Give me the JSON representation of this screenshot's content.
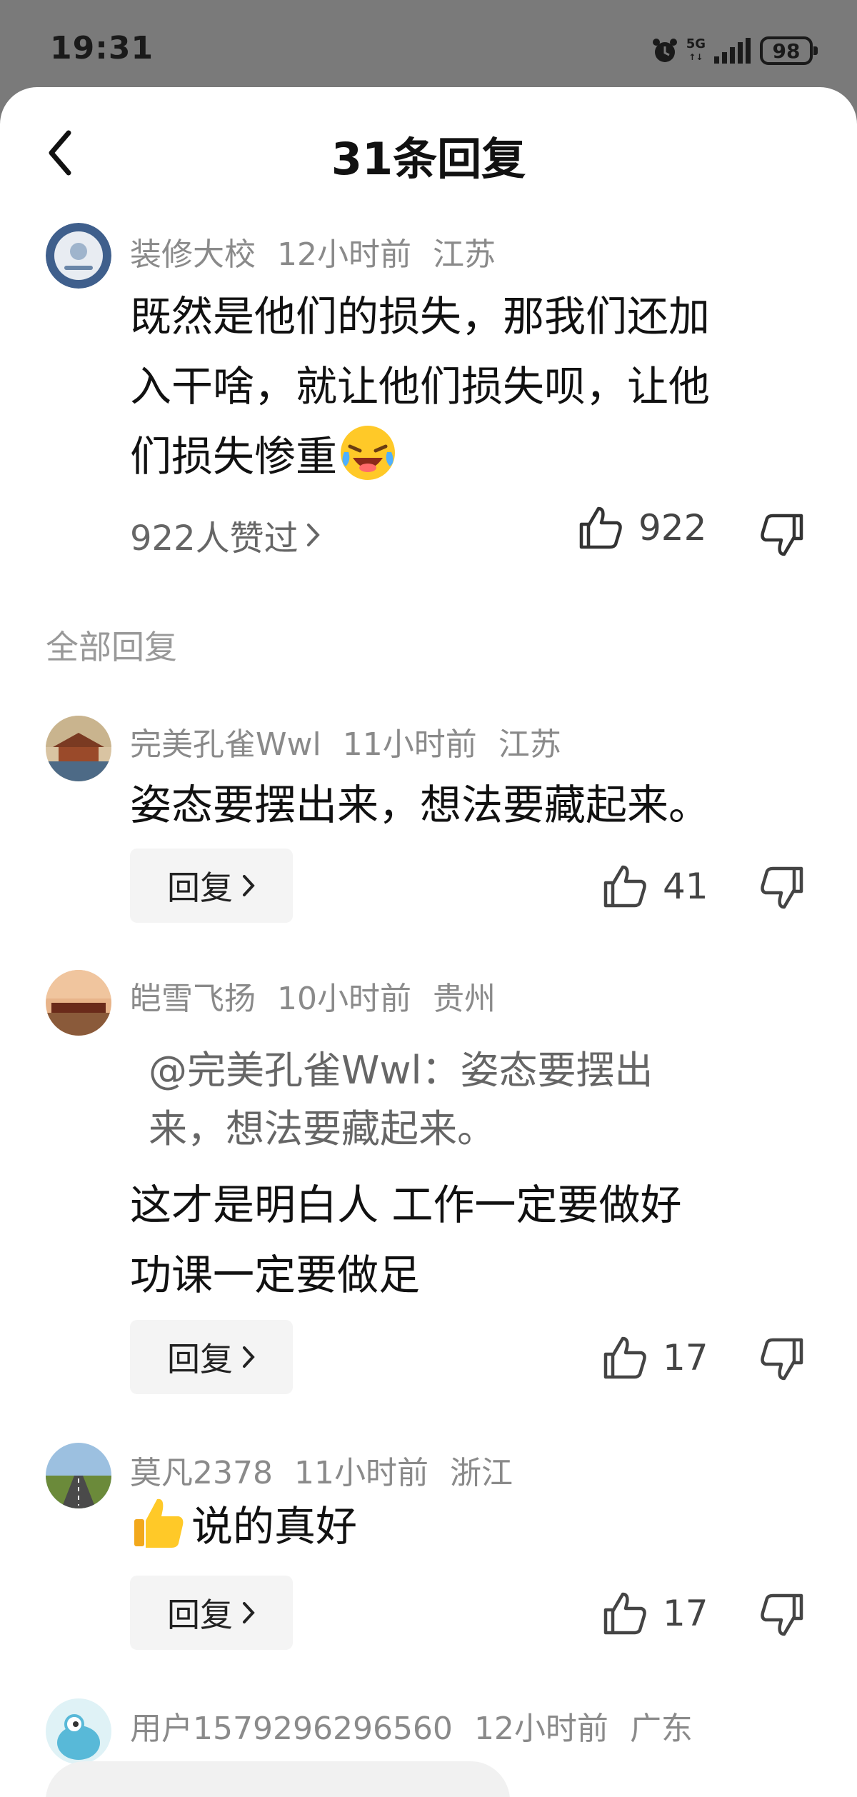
{
  "status_bar": {
    "time": "19:31",
    "network": "5G",
    "battery": "98"
  },
  "header": {
    "title": "31条回复"
  },
  "main_comment": {
    "username": "装修大校",
    "time": "12小时前",
    "location": "江苏",
    "text_lines": [
      "既然是他们的损失，那我们还加",
      "入干啥，就让他们损失呗，让他",
      "们损失惨重"
    ],
    "liked_by": "922人赞过",
    "likes": "922"
  },
  "section_label": "全部回复",
  "replies": [
    {
      "username": "完美孔雀Wwl",
      "time": "11小时前",
      "location": "江苏",
      "text": "姿态要摆出来，想法要藏起来。",
      "likes": "41",
      "reply_label": "回复"
    },
    {
      "username": "皑雪飞扬",
      "time": "10小时前",
      "location": "贵州",
      "quote_lines": [
        "@完美孔雀Wwl：姿态要摆出",
        "来，想法要藏起来。"
      ],
      "text_lines": [
        "这才是明白人 工作一定要做好",
        "功课一定要做足"
      ],
      "likes": "17",
      "reply_label": "回复"
    },
    {
      "username": "莫凡2378",
      "time": "11小时前",
      "location": "浙江",
      "text": "说的真好",
      "likes": "17",
      "reply_label": "回复"
    },
    {
      "username": "用户1579296296560",
      "time": "12小时前",
      "location": "广东"
    }
  ],
  "icons": {
    "back": "chevron-left-icon",
    "like": "thumb-up-icon",
    "dislike": "thumb-down-icon",
    "chevron": "chevron-right-icon"
  }
}
